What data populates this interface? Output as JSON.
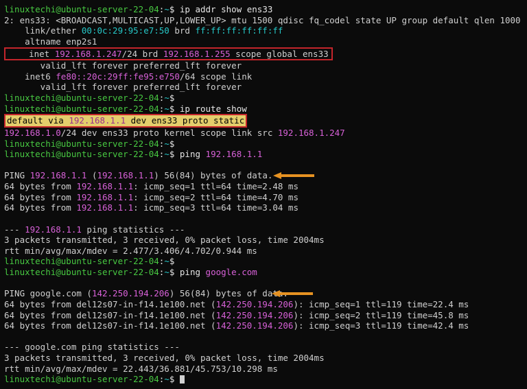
{
  "prompt_user": "linuxtechi@ubuntu-server-22-04",
  "prompt_sep": ":",
  "prompt_path": "~",
  "prompt_dollar": "$",
  "cmd1": "ip addr show ens33",
  "if": {
    "idx": "2: ens33: <BROADCAST,MULTICAST,UP,LOWER_UP> mtu 1500 qdisc fq_codel state UP group default qlen 1000",
    "link_pre": "    link/ether ",
    "mac": "00:0c:29:95:e7:50",
    "link_mid": " brd ",
    "brdmac": "ff:ff:ff:ff:ff:ff",
    "altname": "    altname enp2s1",
    "inet_pre": "    inet ",
    "inet_ip": "192.168.1.247",
    "inet_mid": "/24 brd ",
    "inet_brd": "192.168.1.255",
    "inet_post": " scope global ens33",
    "valid1": "       valid_lft forever preferred_lft forever",
    "inet6_pre": "    inet6 ",
    "inet6_ip": "fe80::20c:29ff:fe95:e750",
    "inet6_post": "/64 scope link",
    "valid2": "       valid_lft forever preferred_lft forever"
  },
  "cmd2": "ip route show",
  "route_default_1": "default",
  "route_default_2": " via ",
  "route_default_ip": "192.168.1.1",
  "route_default_3": " dev ens33 proto static",
  "route_net": "192.168.1.0",
  "route_net_mid": "/24 dev ens33 proto kernel scope link src ",
  "route_net_src": "192.168.1.247",
  "cmd3_pre": "ping ",
  "cmd3_ip": "192.168.1.1",
  "ping1_hdr_pre": "PING ",
  "ping1_hdr_ip": "192.168.1.1",
  "ping1_hdr_mid": " (",
  "ping1_hdr_ip2": "192.168.1.1",
  "ping1_hdr_post": ") 56(84) bytes of data.",
  "ping1_l1_pre": "64 bytes from ",
  "ping1_l1_ip": "192.168.1.1",
  "ping1_l1_post": ": icmp_seq=1 ttl=64 time=2.48 ms",
  "ping1_l2_post": ": icmp_seq=2 ttl=64 time=4.70 ms",
  "ping1_l3_post": ": icmp_seq=3 ttl=64 time=3.04 ms",
  "ping1_stats_pre": "--- ",
  "ping1_stats_ip": "192.168.1.1",
  "ping1_stats_post": " ping statistics ---",
  "ping1_sum1": "3 packets transmitted, 3 received, 0% packet loss, time 2004ms",
  "ping1_sum2": "rtt min/avg/max/mdev = 2.477/3.406/4.702/0.944 ms",
  "cmd4_pre": "ping ",
  "cmd4_host": "google.com",
  "ping2_hdr_pre": "PING google.com (",
  "ping2_hdr_ip": "142.250.194.206",
  "ping2_hdr_post": ") 56(84) bytes of data.",
  "ping2_line_pre": "64 bytes from del12s07-in-f14.1e100.net (",
  "ping2_line_ip": "142.250.194.206",
  "ping2_l1_post": "): icmp_seq=1 ttl=119 time=22.4 ms",
  "ping2_l2_post": "): icmp_seq=2 ttl=119 time=45.8 ms",
  "ping2_l3_post": "): icmp_seq=3 ttl=119 time=42.4 ms",
  "ping2_stats": "--- google.com ping statistics ---",
  "ping2_sum1": "3 packets transmitted, 3 received, 0% packet loss, time 2004ms",
  "ping2_sum2": "rtt min/avg/max/mdev = 22.443/36.881/45.753/10.298 ms",
  "blank": " "
}
